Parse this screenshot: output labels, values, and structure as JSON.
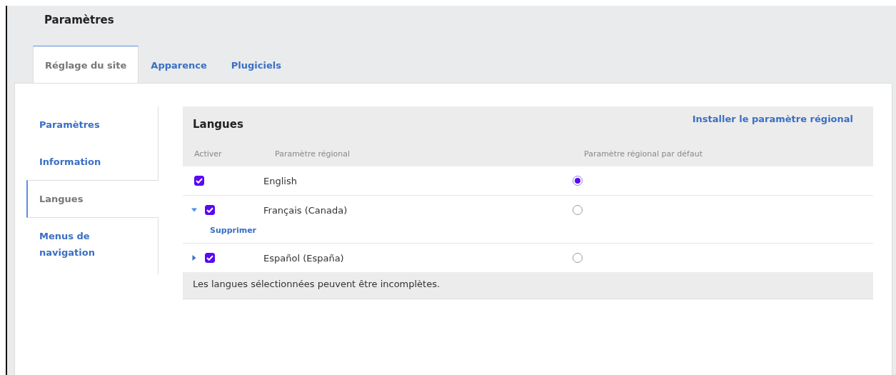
{
  "page": {
    "title": "Paramètres"
  },
  "tabs": [
    {
      "label": "Réglage du site",
      "selected": true
    },
    {
      "label": "Apparence",
      "selected": false
    },
    {
      "label": "Plugiciels",
      "selected": false
    }
  ],
  "side_nav": [
    {
      "label": "Paramètres",
      "selected": false
    },
    {
      "label": "Information",
      "selected": false
    },
    {
      "label": "Langues",
      "selected": true
    },
    {
      "label": "Menus de navigation",
      "selected": false
    }
  ],
  "languages": {
    "title": "Langues",
    "install_link": "Installer le paramètre régional",
    "columns": [
      "Activer",
      "Paramètre régional",
      "Paramètre régional par défaut"
    ],
    "rows": [
      {
        "kind": "plain",
        "enabled": true,
        "locale": "English",
        "default": true
      },
      {
        "kind": "expandable",
        "expanded": true,
        "enabled": true,
        "locale": "Français (Canada)",
        "default": false,
        "action": "Supprimer"
      },
      {
        "kind": "expandable",
        "expanded": false,
        "enabled": true,
        "locale": "Español (España)",
        "default": false
      }
    ],
    "footer": "Les langues sélectionnées peuvent être incomplètes."
  }
}
